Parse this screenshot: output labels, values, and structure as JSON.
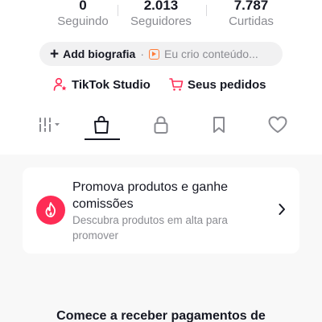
{
  "stats": {
    "following": {
      "value": "0",
      "label": "Seguindo"
    },
    "followers": {
      "value": "2.013",
      "label": "Seguidores"
    },
    "likes": {
      "value": "7.787",
      "label": "Curtidas"
    }
  },
  "bio": {
    "add_label": "Add biografia",
    "separator": "·",
    "video_icon": "play-square-icon",
    "video_text": "Eu crio conteúdo..."
  },
  "links": {
    "studio": {
      "label": "TikTok Studio",
      "icon": "person-star-icon",
      "icon_color": "#fe2c55"
    },
    "orders": {
      "label": "Seus pedidos",
      "icon": "cart-icon",
      "icon_color": "#fe2c55"
    }
  },
  "tabs": [
    {
      "name": "videos",
      "icon": "grid-bars-icon",
      "active": false
    },
    {
      "name": "shop",
      "icon": "shopping-bag-icon",
      "active": true
    },
    {
      "name": "private",
      "icon": "lock-icon",
      "active": false
    },
    {
      "name": "saved",
      "icon": "bookmark-icon",
      "active": false
    },
    {
      "name": "liked",
      "icon": "heart-icon",
      "active": false
    }
  ],
  "promo_card": {
    "icon": "flame-icon",
    "icon_bg": "#fe2c55",
    "title": "Promova produtos e ganhe comissões",
    "subtitle": "Descubra produtos em alta para promover"
  },
  "bottom_text": "Comece a receber pagamentos de",
  "colors": {
    "accent": "#fe2c55",
    "text": "#161823",
    "muted": "#8a8b91",
    "background_gray": "#f8f8f8"
  }
}
